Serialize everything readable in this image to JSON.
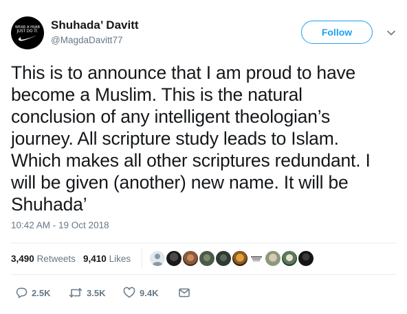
{
  "author": {
    "avatar_text_line1": "WEAR A HIJAB",
    "avatar_text_line2": "JUST DO IT.",
    "name": "Shuhada’ Davitt",
    "handle": "@MagdaDavitt77"
  },
  "follow_label": "Follow",
  "tweet": {
    "lines": [
      "This is to announce that I am proud to have",
      "become a Muslim. This is the natural",
      "conclusion of any intelligent theologian’s",
      "journey. All scripture study leads to Islam.",
      "Which makes all other scriptures redundant. I",
      "will be given (another) new name. It will be",
      "Shuhada’"
    ]
  },
  "timestamp": "10:42 AM - 19 Oct 2018",
  "stats": {
    "retweets_count": "3,490",
    "retweets_label": "Retweets",
    "likes_count": "9,410",
    "likes_label": "Likes"
  },
  "actions": {
    "reply_count": "2.5K",
    "retweet_count": "3.5K",
    "like_count": "9.4K"
  },
  "icons": [
    "chevron-down-icon",
    "nike-swoosh-icon",
    "reply-icon",
    "retweet-icon",
    "heart-icon",
    "message-icon"
  ],
  "colors": {
    "accent": "#1da1f2",
    "secondary_text": "#657786",
    "primary_text": "#14171a",
    "divider": "#e6ecf0"
  }
}
